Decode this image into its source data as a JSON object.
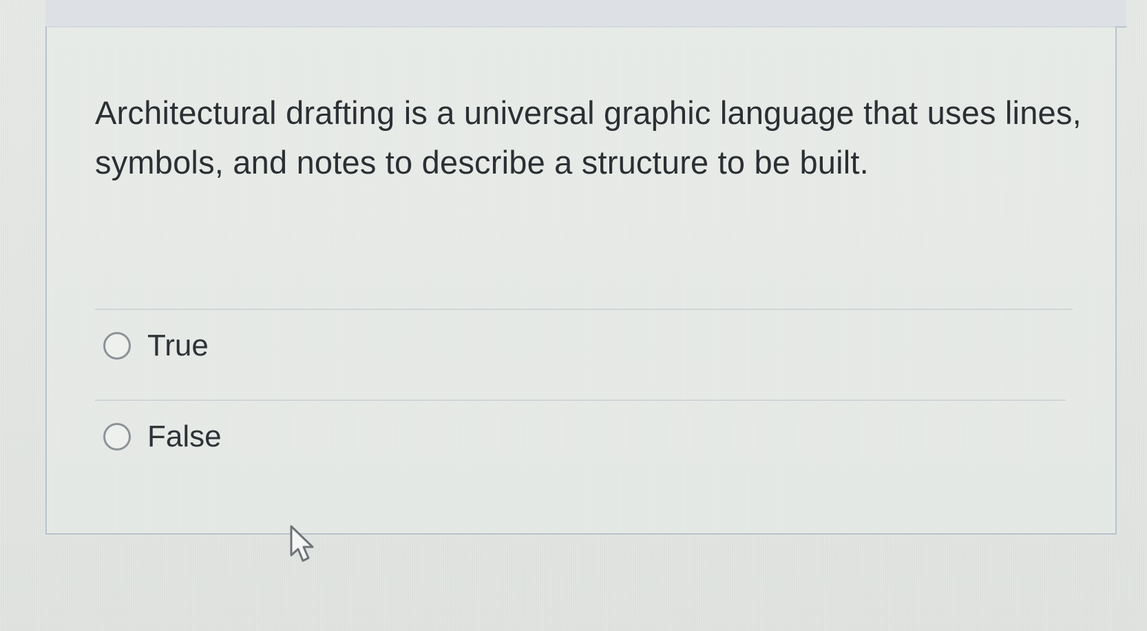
{
  "question": {
    "text": "Architectural drafting is a universal graphic language that uses lines, symbols, and notes to describe a structure to be built."
  },
  "answers": [
    {
      "label": "True",
      "selected": false
    },
    {
      "label": "False",
      "selected": false
    }
  ],
  "colors": {
    "card_border": "#b9c3cd",
    "text": "#2c2f33",
    "radio_border": "#8c9296",
    "divider": "#cfd5d8"
  },
  "icons": {
    "radio": "radio-unchecked-icon",
    "cursor": "mouse-pointer-icon"
  }
}
